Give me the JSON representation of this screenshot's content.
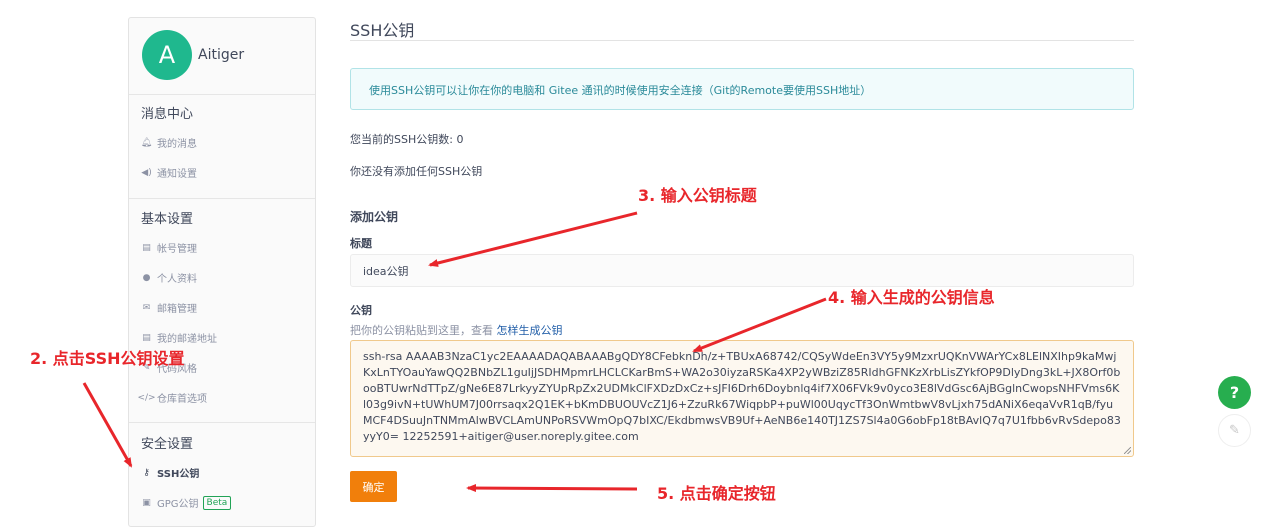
{
  "sidebar": {
    "avatar_letter": "A",
    "username": "Aitiger",
    "groups": [
      {
        "title": "消息中心",
        "items": [
          {
            "label": "我的消息",
            "icon": "bell-icon"
          },
          {
            "label": "通知设置",
            "icon": "speaker-icon"
          }
        ]
      },
      {
        "title": "基本设置",
        "items": [
          {
            "label": "帐号管理",
            "icon": "id-card-icon"
          },
          {
            "label": "个人资料",
            "icon": "user-icon"
          },
          {
            "label": "邮箱管理",
            "icon": "envelope-icon"
          },
          {
            "label": "我的邮递地址",
            "icon": "address-card-icon"
          },
          {
            "label": "代码风格",
            "icon": "brush-icon"
          },
          {
            "label": "仓库首选项",
            "icon": "code-icon"
          }
        ]
      },
      {
        "title": "安全设置",
        "items": [
          {
            "label": "SSH公钥",
            "icon": "key-icon"
          },
          {
            "label": "GPG公钥",
            "icon": "lock-icon",
            "badge": "Beta"
          }
        ]
      }
    ]
  },
  "main": {
    "title": "SSH公钥",
    "info": "使用SSH公钥可以让你在你的电脑和 Gitee 通讯的时候使用安全连接（Git的Remote要使用SSH地址）",
    "count_text": "您当前的SSH公钥数: 0",
    "empty_text": "你还没有添加任何SSH公钥",
    "add_title": "添加公钥",
    "label_title": "标题",
    "title_value": "idea公钥",
    "label_key": "公钥",
    "hint_prefix": "把你的公钥粘贴到这里，查看",
    "hint_link": "怎样生成公钥",
    "key_value": "ssh-rsa AAAAB3NzaC1yc2EAAAADAQABAAABgQDY8CFebknDh/z+TBUxA68742/CQSyWdeEn3VY5y9MzxrUQKnVWArYCx8LElNXIhp9kaMwjKxLnTYOauYawQQ2BNbZL1guIjJSDHMpmrLHCLCKarBmS+WA2o30iyzaRSKa4XP2yWBziZ85RIdhGFNKzXrbLisZYkfOP9DlyDng3kL+JX8Orf0booBTUwrNdTTpZ/gNe6E87LrkyyZYUpRpZx2UDMkClFXDzDxCz+sJFI6Drh6Doybnlq4if7X06FVk9v0yco3E8lVdGsc6AjBGglnCwopsNHFVms6Kl03g9ivN+tUWhUM7J00rrsaqx2Q1EK+bKmDBUOUVcZ1J6+ZzuRk67WiqpbP+puWl00UqycTf3OnWmtbwV8vLjxh75dANiX6eqaVvR1qB/fyuMCF4DSuuJnTNMmAlwBVCLAmUNPoRSVWmOpQ7bIXC/EkdbmwsVB9Uf+AeNB6e140TJ1ZS7Sl4a0G6obFp18tBAvlQ7q7U1fbb6vRvSdepo83yyY0= 12252591+aitiger@user.noreply.gitee.com",
    "ok_button": "确定"
  },
  "annotations": {
    "step2": "2. 点击SSH公钥设置",
    "step3": "3. 输入公钥标题",
    "step4": "4. 输入生成的公钥信息",
    "step5": "5. 点击确定按钮",
    "color": "#e8262b"
  },
  "floating": {
    "help": "?"
  }
}
